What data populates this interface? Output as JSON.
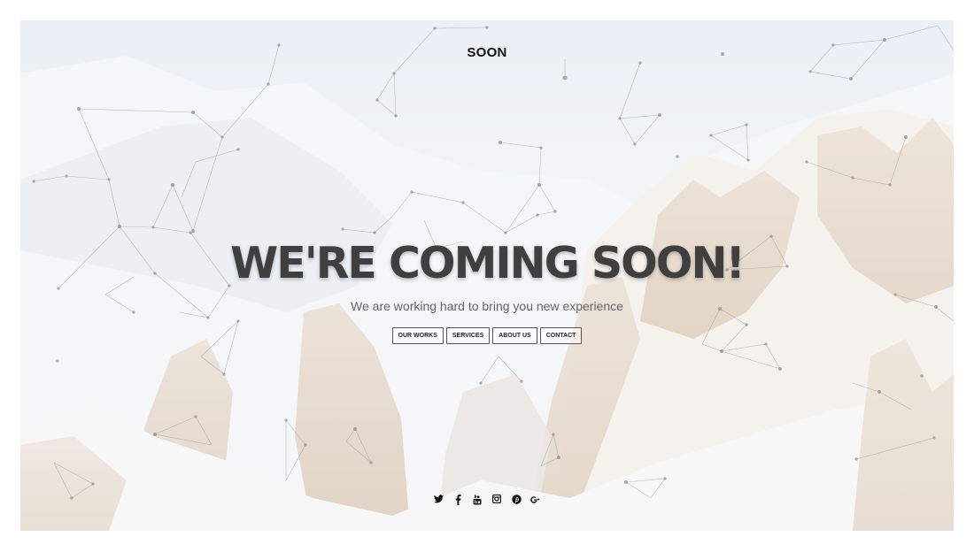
{
  "brand": {
    "name": "SOON"
  },
  "hero": {
    "headline": "WE'RE COMING SOON!",
    "subline": "We are working hard to bring you new experience"
  },
  "nav": [
    {
      "label": "OUR WORKS"
    },
    {
      "label": "SERVICES"
    },
    {
      "label": "ABOUT US"
    },
    {
      "label": "CONTACT"
    }
  ],
  "social": [
    {
      "icon": "twitter-icon",
      "glyph": "𝕥"
    },
    {
      "icon": "facebook-icon",
      "glyph": "f"
    },
    {
      "icon": "youtube-icon",
      "glyph": "▶"
    },
    {
      "icon": "instagram-icon",
      "glyph": "◘"
    },
    {
      "icon": "pinterest-icon",
      "glyph": "℗"
    },
    {
      "icon": "google-plus-icon",
      "glyph": "g+"
    }
  ]
}
